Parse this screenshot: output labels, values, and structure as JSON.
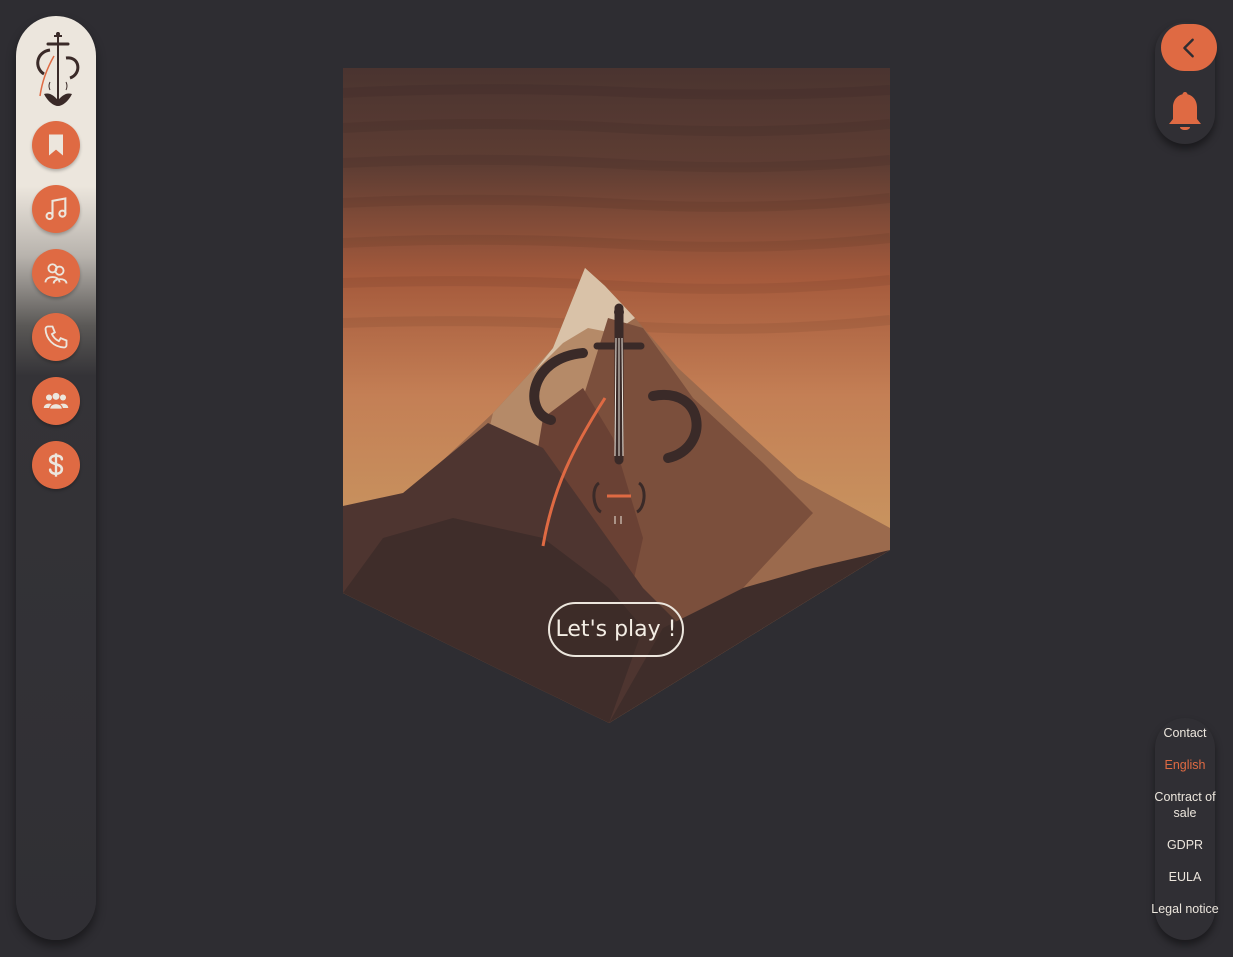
{
  "sidebar": {
    "logo_icon": "cello-logo-icon",
    "items": [
      {
        "name": "bookmark-icon"
      },
      {
        "name": "music-note-icon"
      },
      {
        "name": "users-icon"
      },
      {
        "name": "phone-icon"
      },
      {
        "name": "group-icon"
      },
      {
        "name": "dollar-icon"
      }
    ]
  },
  "hero": {
    "artwork_icon": "mountain-cello-illustration",
    "button_label": "Let's play !"
  },
  "header": {
    "back_icon": "chevron-left-icon",
    "notification_icon": "bell-icon"
  },
  "footer": {
    "links": [
      "Contact",
      "English",
      "Contract of sale",
      "GDPR",
      "EULA",
      "Legal notice"
    ],
    "active_link": "English"
  },
  "colors": {
    "background": "#2e2d32",
    "accent": "#df6a43",
    "cream": "#ece6dd"
  }
}
